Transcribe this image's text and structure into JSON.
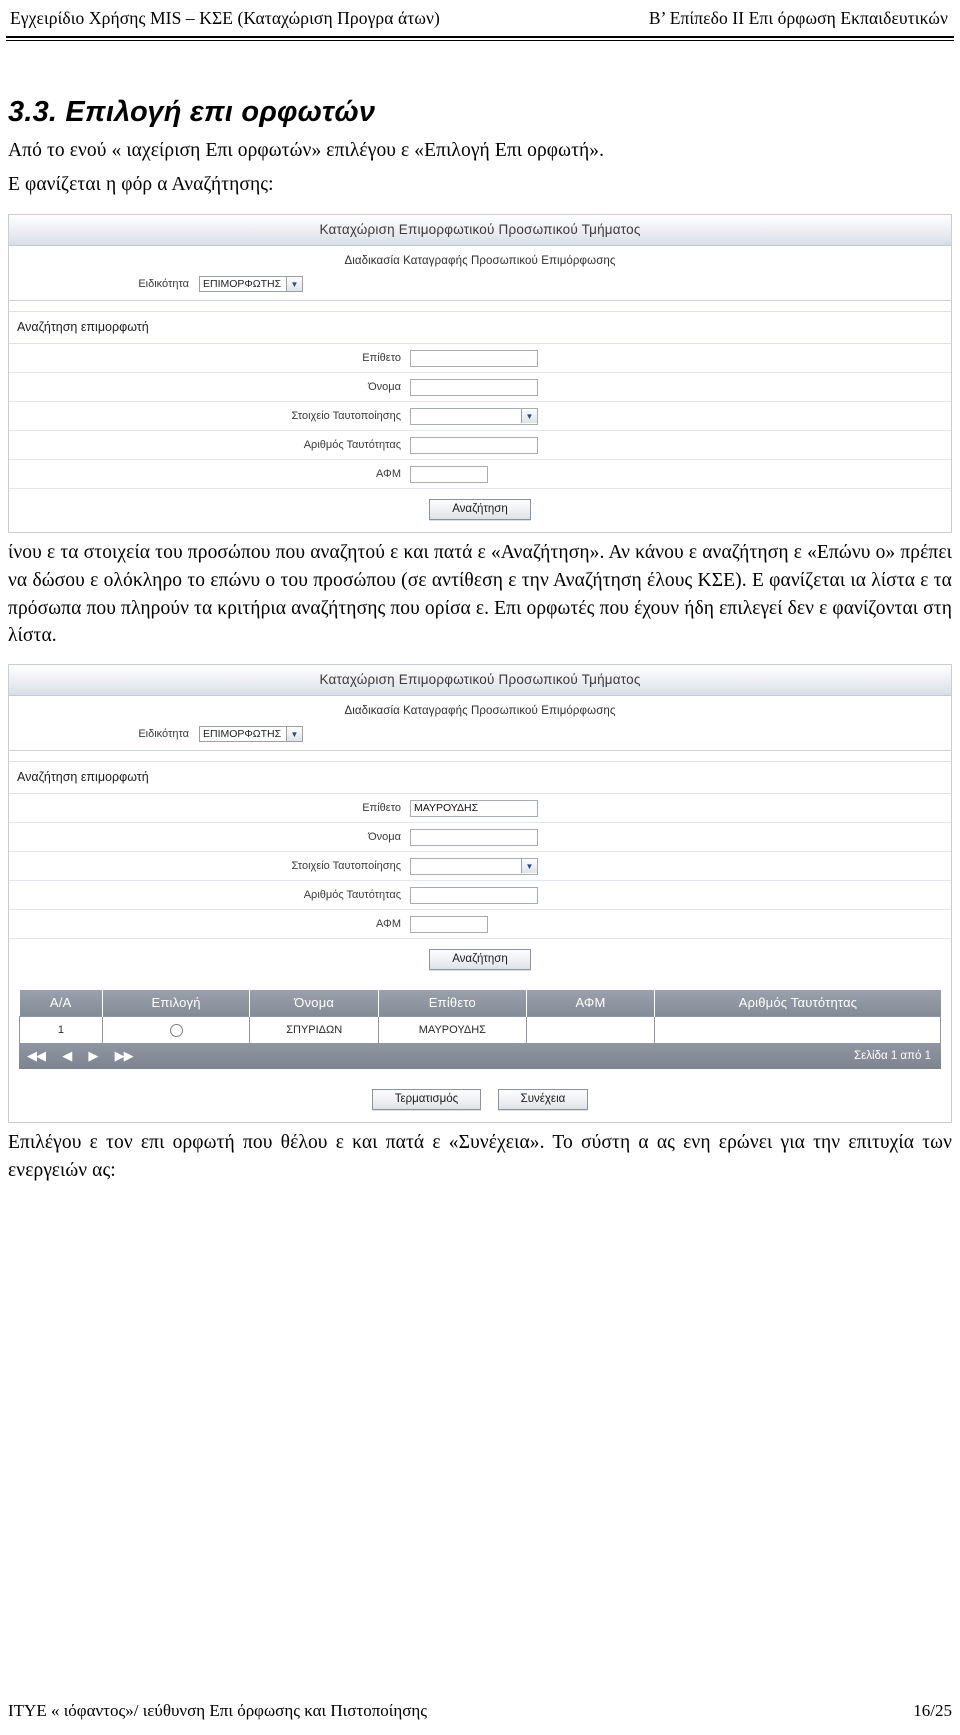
{
  "header": {
    "left": "Εγχειρίδιο Χρήσης MIS – ΚΣΕ (Καταχώριση Προγρα άτων)",
    "right": "Β’ Επίπεδο ΙΙ Επι όρφωση Εκπαιδευτικών"
  },
  "section": {
    "title": "3.3. Επιλογή επι ορφωτών",
    "intro_p1": "Από το  ενού « ιαχείριση Επι ορφωτών» επιλέγου ε «Επιλογή Επι ορφωτή».",
    "intro_p2": "Ε φανίζεται η φόρ α Αναζήτησης:",
    "mid_p1": " ίνου ε τα στοιχεία του προσώπου που αναζητού ε και πατά ε «Αναζήτηση». Αν κάνου ε αναζήτηση  ε «Επώνυ ο» πρέπει να δώσου ε ολόκληρο το επώνυ ο του προσώπου (σε αντίθεση  ε την Αναζήτηση  έλους ΚΣΕ). Ε φανίζεται  ια λίστα  ε τα πρόσωπα που πληρούν τα κριτήρια αναζήτησης που ορίσα ε. Επι ορφωτές που έχουν ήδη επιλεγεί δεν ε φανίζονται στη λίστα.",
    "end_p1": "Επιλέγου ε τον επι ορφωτή που θέλου ε και πατά ε «Συνέχεια». Το σύστη α  ας ενη ερώνει για την επιτυχία των ενεργειών  ας:"
  },
  "screenshot1": {
    "app_title": "Καταχώριση Επιμορφωτικού Προσωπικού Τμήματος",
    "app_subtitle": "Διαδικασία Καταγραφής Προσωπικού Επιμόρφωσης",
    "specialty_label": "Ειδικότητα",
    "specialty_value": "ΕΠΙΜΟΡΦΩΤΗΣ",
    "search_section_title": "Αναζήτηση επιμορφωτή",
    "fields": [
      {
        "label": "Επίθετο",
        "value": "",
        "kind": "text",
        "width": "w-wide"
      },
      {
        "label": "Όνομα",
        "value": "",
        "kind": "text",
        "width": "w-mid"
      },
      {
        "label": "Στοιχείο Ταυτοποίησης",
        "value": "",
        "kind": "select",
        "width": "w-mid"
      },
      {
        "label": "Αριθμός Ταυτότητας",
        "value": "",
        "kind": "text",
        "width": "w-mid"
      },
      {
        "label": "ΑΦΜ",
        "value": "",
        "kind": "text",
        "width": "w-narrow"
      }
    ],
    "search_button": "Αναζήτηση"
  },
  "screenshot2": {
    "app_title": "Καταχώριση Επιμορφωτικού Προσωπικού Τμήματος",
    "app_subtitle": "Διαδικασία Καταγραφής Προσωπικού Επιμόρφωσης",
    "specialty_label": "Ειδικότητα",
    "specialty_value": "ΕΠΙΜΟΡΦΩΤΗΣ",
    "search_section_title": "Αναζήτηση επιμορφωτή",
    "fields": [
      {
        "label": "Επίθετο",
        "value": "ΜΑΥΡΟΥΔΗΣ",
        "kind": "text",
        "width": "w-wide"
      },
      {
        "label": "Όνομα",
        "value": "",
        "kind": "text",
        "width": "w-mid"
      },
      {
        "label": "Στοιχείο Ταυτοποίησης",
        "value": "",
        "kind": "select",
        "width": "w-mid"
      },
      {
        "label": "Αριθμός Ταυτότητας",
        "value": "",
        "kind": "text",
        "width": "w-mid"
      },
      {
        "label": "ΑΦΜ",
        "value": "",
        "kind": "text",
        "width": "w-narrow"
      }
    ],
    "search_button": "Αναζήτηση",
    "grid": {
      "columns": [
        "Α/Α",
        "Επιλογή",
        "Όνομα",
        "Επίθετο",
        "ΑΦΜ",
        "Αριθμός Ταυτότητας"
      ],
      "rows": [
        {
          "aa": "1",
          "select": "radio",
          "onoma": "ΣΠΥΡΙΔΩΝ",
          "epitheto": "ΜΑΥΡΟΥΔΗΣ",
          "afm": "",
          "tautotita": ""
        }
      ],
      "pager_first": "◀◀",
      "pager_prev": "◀",
      "pager_next": "▶",
      "pager_last": "▶▶",
      "pager_text": "Σελίδα 1 από 1"
    },
    "finish_button": "Τερματισμός",
    "continue_button": "Συνέχεια"
  },
  "footer": {
    "left": "ΙΤΥΕ  «  ιόφαντος»/   ιεύθυνση Επι όρφωσης και Πιστοποίησης",
    "right": "16/25"
  }
}
